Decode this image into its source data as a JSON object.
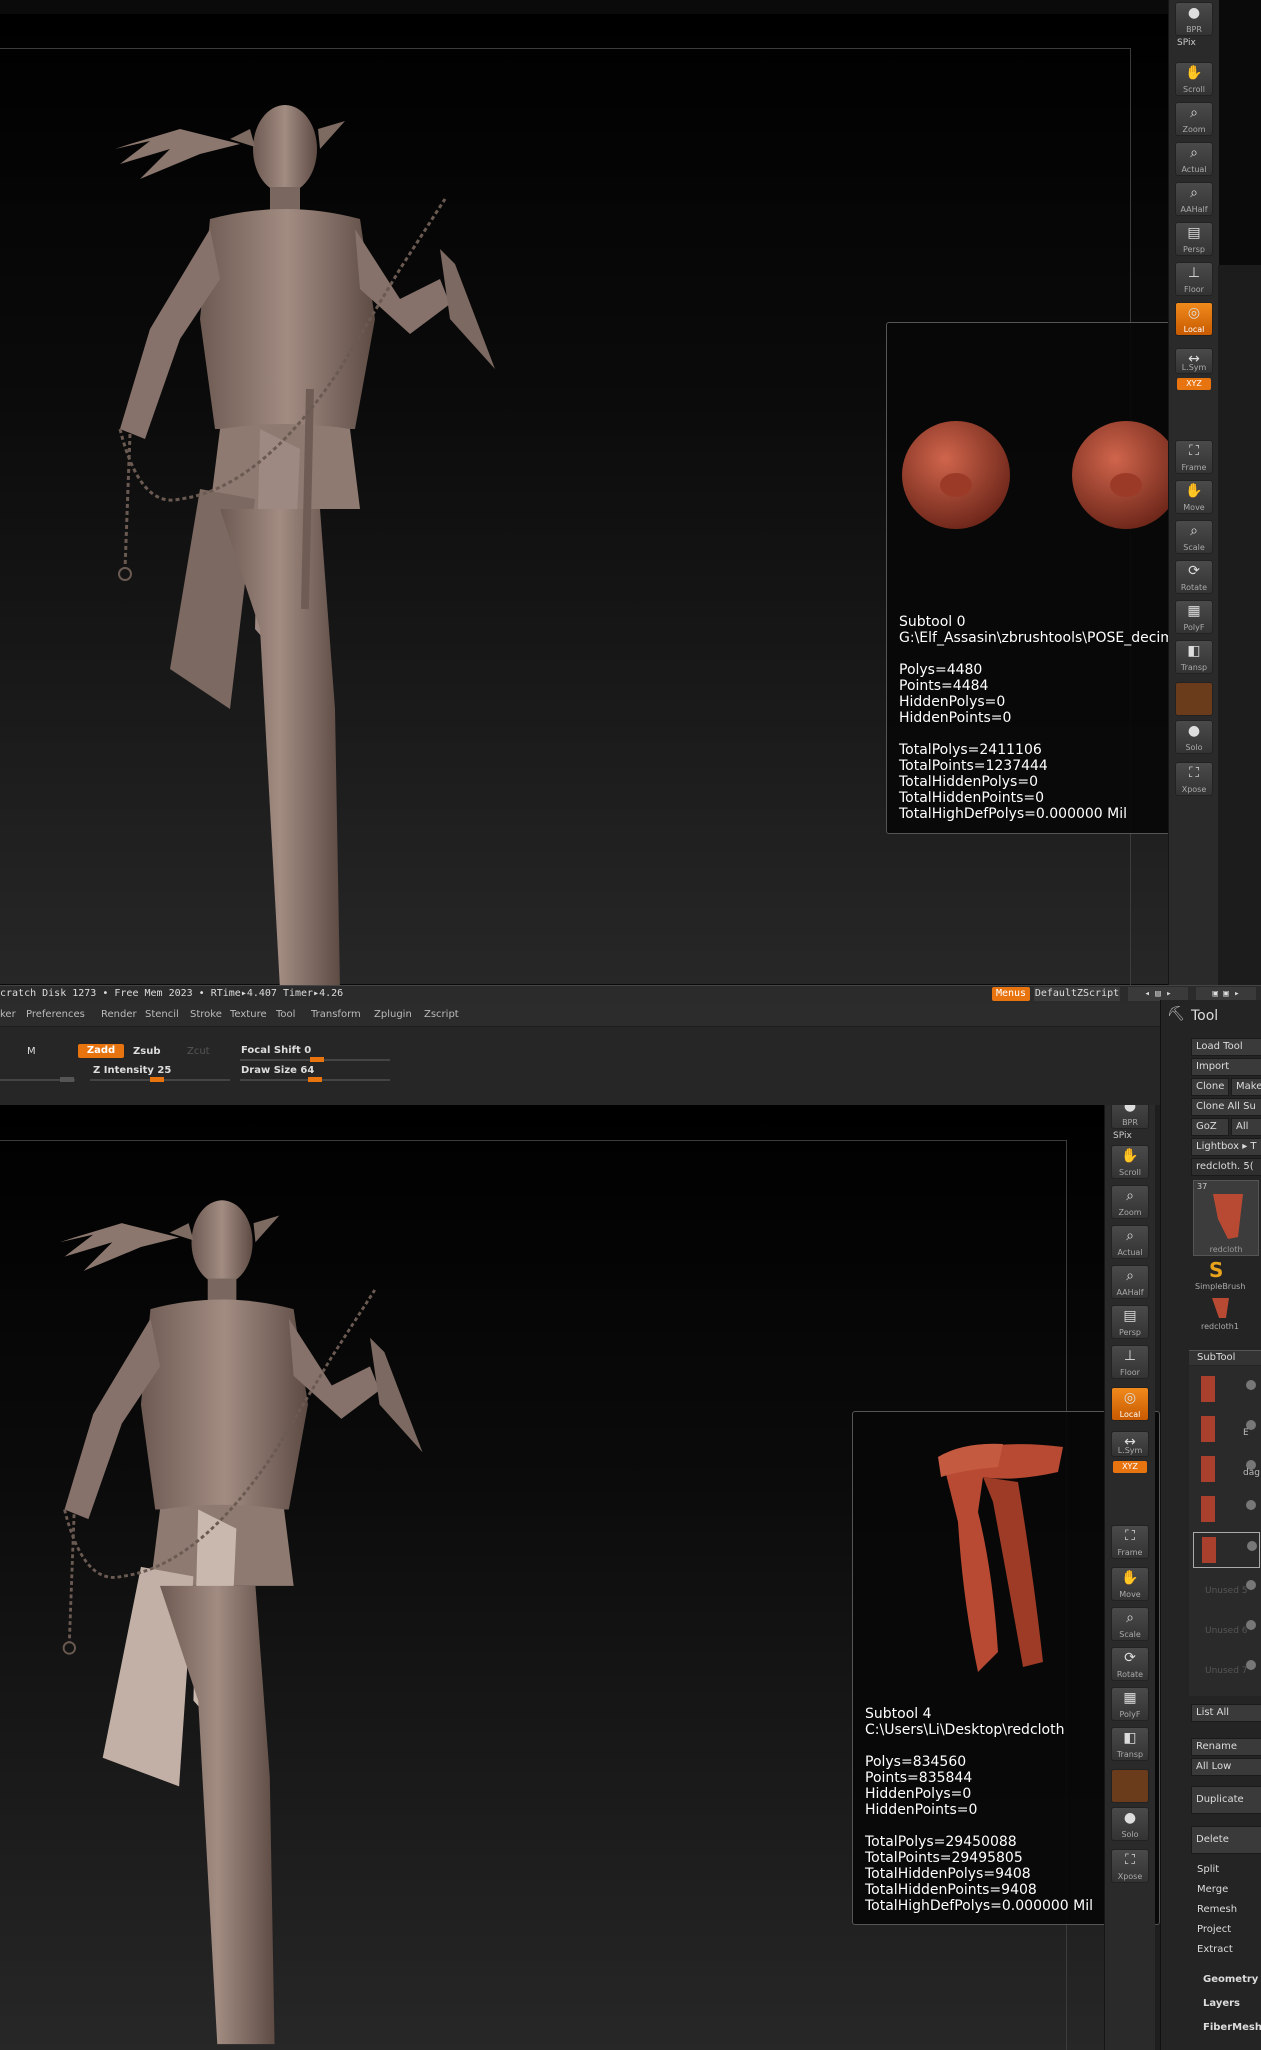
{
  "toolbar_labels": {
    "bpr": "BPR",
    "spix": "SPix",
    "scroll": "Scroll",
    "zoom": "Zoom",
    "actual": "Actual",
    "aahalf": "AAHalf",
    "persp": "Persp",
    "floor": "Floor",
    "local": "Local",
    "lsym": "L.Sym",
    "xyz": "XYZ",
    "frame": "Frame",
    "move": "Move",
    "scale": "Scale",
    "rotate": "Rotate",
    "polyf": "PolyF",
    "transp": "Transp",
    "solo": "Solo",
    "xpose": "Xpose"
  },
  "top_info": {
    "lines": [
      "Subtool 0",
      "G:\\Elf_Assasin\\zbrushtools\\POSE_decimate",
      "",
      "Polys=4480",
      "Points=4484",
      "HiddenPolys=0",
      "HiddenPoints=0",
      "",
      "TotalPolys=2411106",
      "TotalPoints=1237444",
      "TotalHiddenPolys=0",
      "TotalHiddenPoints=0",
      "TotalHighDefPolys=0.000000 Mil"
    ]
  },
  "bottom_info": {
    "lines": [
      "Subtool 4",
      "C:\\Users\\Li\\Desktop\\redcloth",
      "",
      "Polys=834560",
      "Points=835844",
      "HiddenPolys=0",
      "HiddenPoints=0",
      "",
      "TotalPolys=29450088",
      "TotalPoints=29495805",
      "TotalHiddenPolys=9408",
      "TotalHiddenPoints=9408",
      "TotalHighDefPolys=0.000000 Mil"
    ]
  },
  "status_bar": {
    "text": "cratch Disk 1273 • Free Mem 2023 • RTime▸4.407 Timer▸4.26",
    "menus": "Menus",
    "script": "DefaultZScript"
  },
  "menu_bar": {
    "items": [
      "ker",
      "Preferences",
      "Render",
      "Stencil",
      "Stroke",
      "Texture",
      "Tool",
      "Transform",
      "Zplugin",
      "Zscript"
    ]
  },
  "shelf": {
    "m": "M",
    "zadd": "Zadd",
    "zsub": "Zsub",
    "zcut": "Zcut",
    "focal_shift": "Focal Shift 0",
    "z_intensity": "Z Intensity 25",
    "draw_size": "Draw Size 64"
  },
  "tool_panel": {
    "title": "Tool",
    "load_tool": "Load Tool",
    "import": "Import",
    "clone": "Clone",
    "make": "Make",
    "clone_all": "Clone All Su",
    "goz": "GoZ",
    "all": "All",
    "lightbox": "Lightbox ▸ T",
    "redcloth_value": "redcloth. 5(",
    "thumb_count": "37",
    "thumb1": "redcloth",
    "thumb2": "SimpleBrush",
    "thumb3": "redcloth1",
    "subtool": "SubTool",
    "subtool_items": [
      "E",
      "dag",
      "Unused 5",
      "Unused 6",
      "Unused 7"
    ],
    "list_all": "List All",
    "rename": "Rename",
    "all_low": "All Low",
    "duplicate": "Duplicate",
    "delete": "Delete",
    "split": "Split",
    "merge": "Merge",
    "remesh": "Remesh",
    "project": "Project",
    "extract": "Extract",
    "geometry": "Geometry",
    "layers": "Layers",
    "fibermesh": "FiberMesh"
  }
}
